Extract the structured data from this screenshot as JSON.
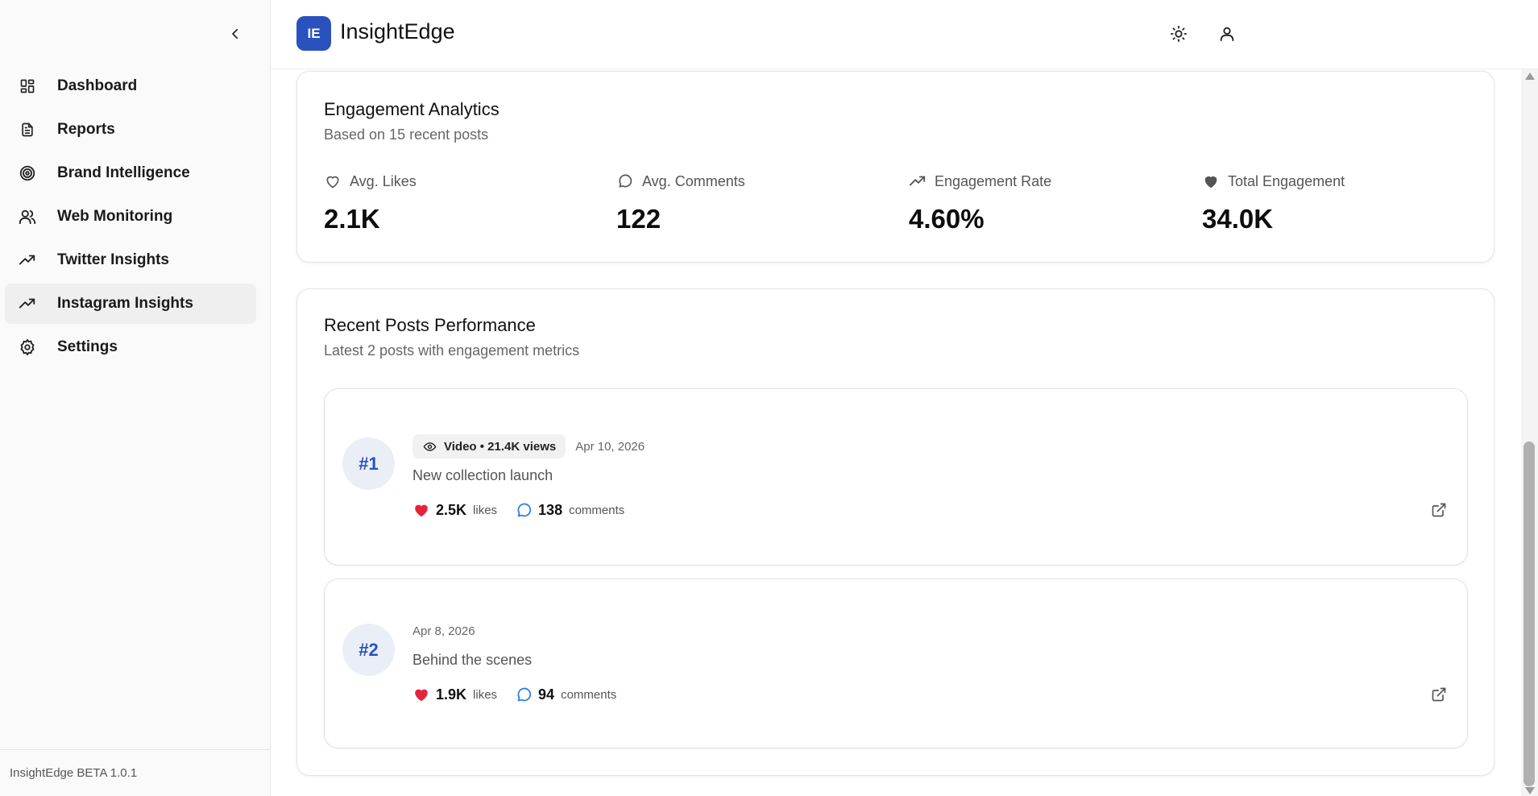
{
  "app": {
    "logo_initials": "IE",
    "title": "InsightEdge"
  },
  "sidebar": {
    "items": [
      {
        "label": "Dashboard",
        "icon": "dashboard-icon",
        "active": false
      },
      {
        "label": "Reports",
        "icon": "document-icon",
        "active": false
      },
      {
        "label": "Brand Intelligence",
        "icon": "target-icon",
        "active": false
      },
      {
        "label": "Web Monitoring",
        "icon": "users-icon",
        "active": false
      },
      {
        "label": "Twitter Insights",
        "icon": "trending-up-icon",
        "active": false
      },
      {
        "label": "Instagram Insights",
        "icon": "trending-up-icon",
        "active": true
      },
      {
        "label": "Settings",
        "icon": "gear-icon",
        "active": false
      }
    ],
    "footer": "InsightEdge BETA 1.0.1"
  },
  "engagement": {
    "title": "Engagement Analytics",
    "subtitle": "Based on 15 recent posts",
    "metrics": [
      {
        "label": "Avg. Likes",
        "value": "2.1K",
        "icon": "heart-outline-icon"
      },
      {
        "label": "Avg. Comments",
        "value": "122",
        "icon": "comment-icon"
      },
      {
        "label": "Engagement Rate",
        "value": "4.60%",
        "icon": "trending-up-icon"
      },
      {
        "label": "Total Engagement",
        "value": "34.0K",
        "icon": "heart-filled-icon"
      }
    ]
  },
  "recent": {
    "title": "Recent Posts Performance",
    "subtitle": "Latest 2 posts with engagement metrics",
    "posts": [
      {
        "rank": "#1",
        "type_badge": "Video • 21.4K views",
        "date": "Apr 10, 2026",
        "caption": "New collection launch",
        "likes": "2.5K",
        "likes_label": "likes",
        "comments": "138",
        "comments_label": "comments"
      },
      {
        "rank": "#2",
        "date": "Apr 8, 2026",
        "caption": "Behind the scenes",
        "likes": "1.9K",
        "likes_label": "likes",
        "comments": "94",
        "comments_label": "comments"
      }
    ]
  },
  "colors": {
    "accent": "#2a52be",
    "like": "#e5243b",
    "comment": "#2b7de9"
  }
}
